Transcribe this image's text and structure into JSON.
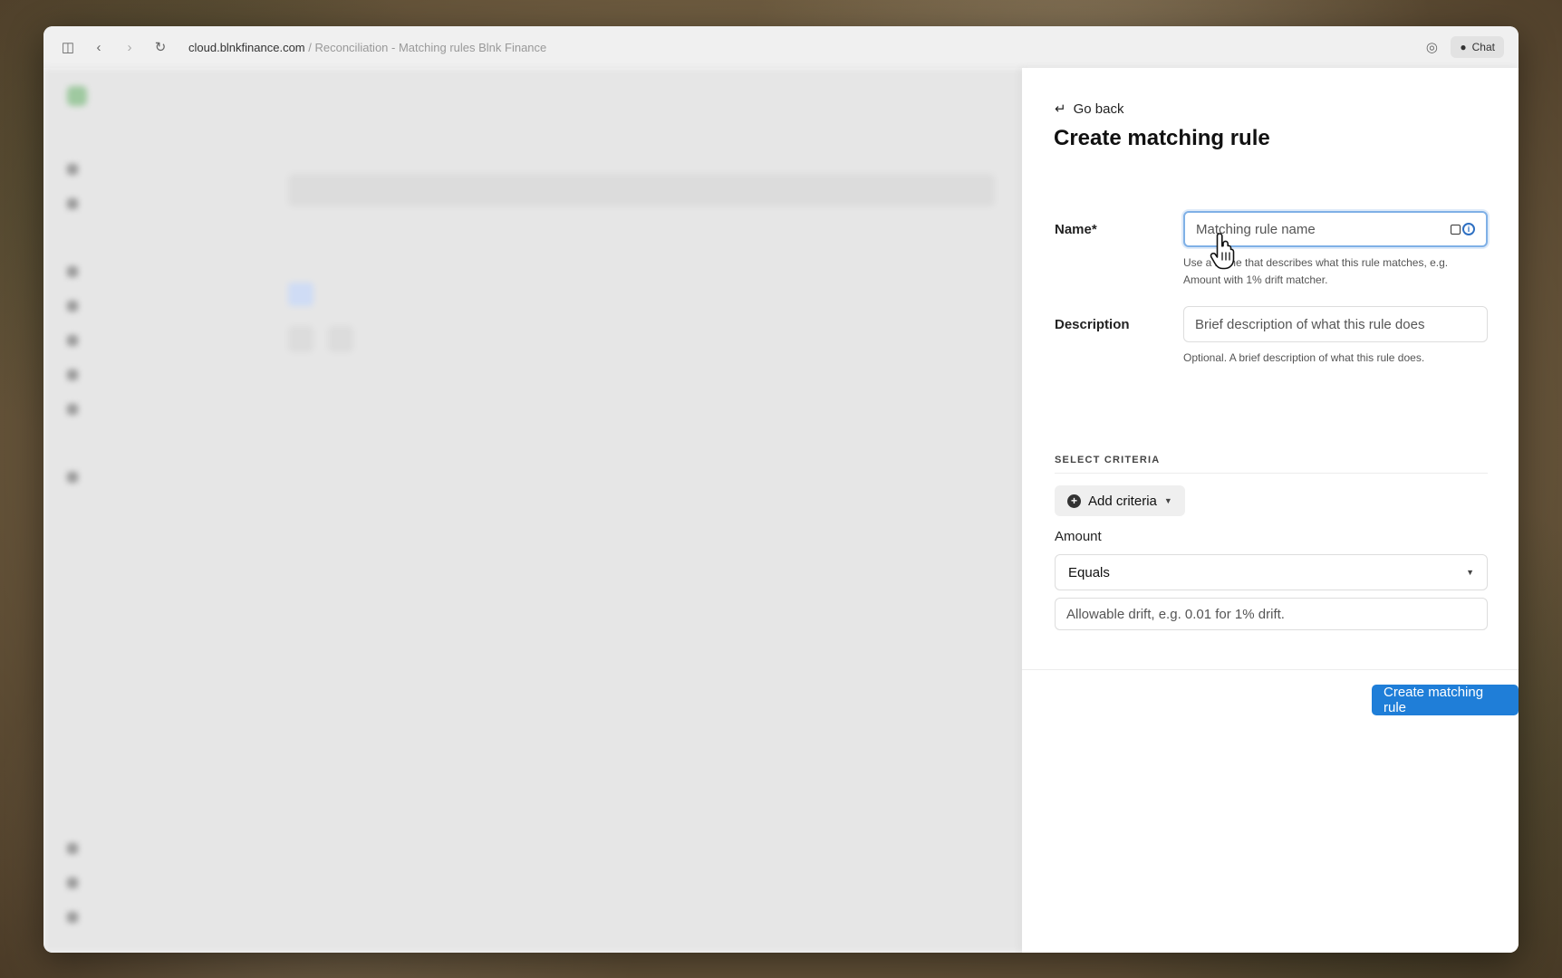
{
  "browser": {
    "url_host": "cloud.blnkfinance.com",
    "url_path": " / Reconciliation - Matching rules Blnk Finance",
    "chat_label": "Chat"
  },
  "panel": {
    "back_label": "Go back",
    "title": "Create matching rule",
    "name_label": "Name*",
    "name_placeholder": "Matching rule name",
    "name_help": "Use a name that describes what this rule matches, e.g. Amount with 1% drift matcher.",
    "description_label": "Description",
    "description_placeholder": "Brief description of what this rule does",
    "description_help": "Optional. A brief description of what this rule does.",
    "criteria_section": "SELECT CRITERIA",
    "add_criteria_label": "Add criteria",
    "amount_label": "Amount",
    "amount_operator": "Equals",
    "drift_placeholder": "Allowable drift, e.g. 0.01 for 1% drift.",
    "submit_label": "Create matching rule"
  },
  "colors": {
    "primary_button": "#1f7ed8",
    "focus_ring": "#7fb0e6"
  }
}
